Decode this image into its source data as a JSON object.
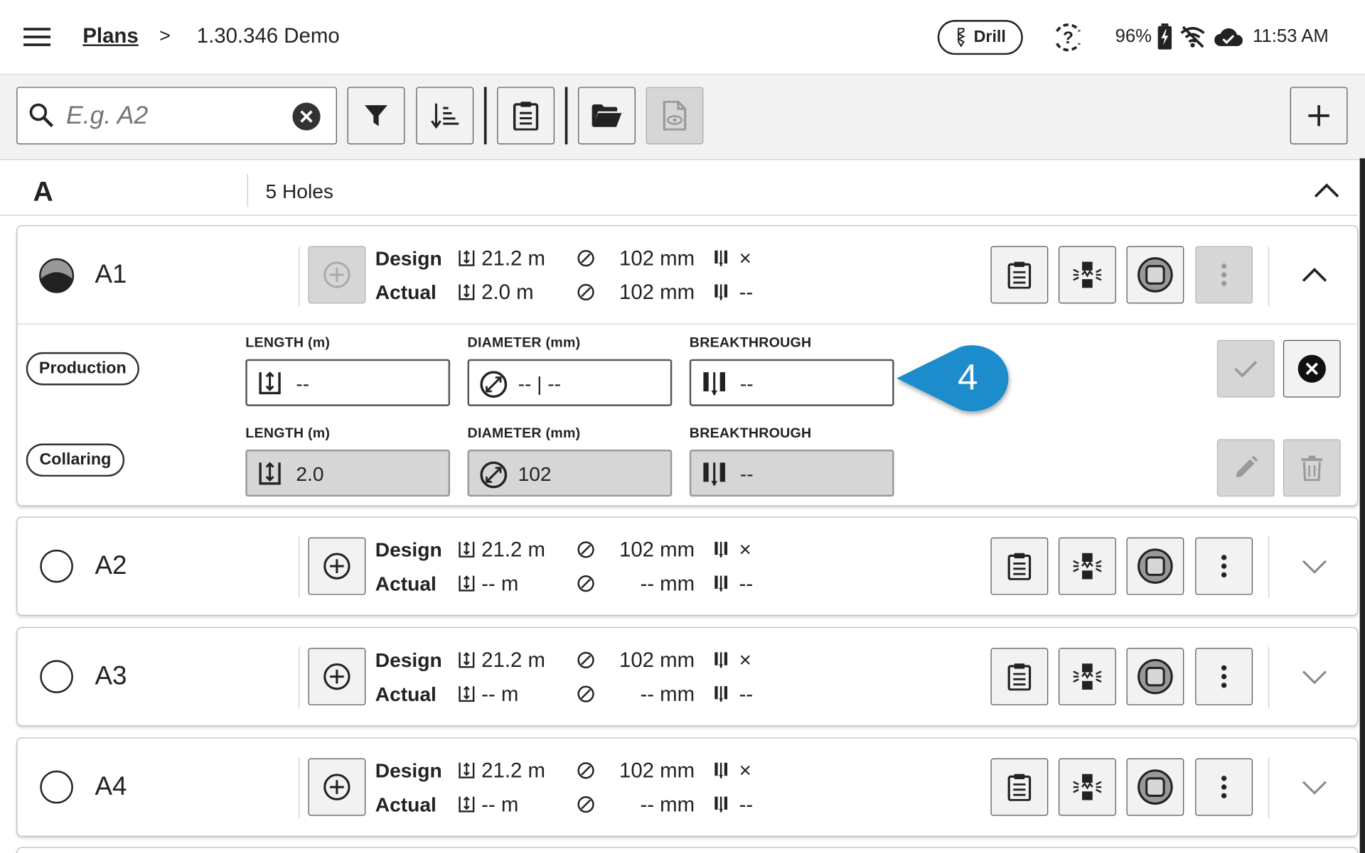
{
  "header": {
    "breadcrumb_link": "Plans",
    "breadcrumb_separator": ">",
    "plan_name": "1.30.346 Demo",
    "mode_label": "Drill",
    "battery": "96%",
    "time": "11:53 AM"
  },
  "search": {
    "placeholder": "E.g. A2",
    "value": ""
  },
  "group": {
    "name": "A",
    "count_label": "5 Holes"
  },
  "labels": {
    "design": "Design",
    "actual": "Actual",
    "length_header": "LENGTH (m)",
    "diameter_header": "DIAMETER (mm)",
    "breakthrough_header": "BREAKTHROUGH",
    "production": "Production",
    "collaring": "Collaring"
  },
  "holes": [
    {
      "id": "A1",
      "status": "partial",
      "expanded": true,
      "design": {
        "length": "21.2 m",
        "diameter": "102 mm",
        "breakthrough": "×"
      },
      "actual": {
        "length": "2.0 m",
        "diameter": "102 mm",
        "breakthrough": "--"
      }
    },
    {
      "id": "A2",
      "status": "empty",
      "expanded": false,
      "design": {
        "length": "21.2 m",
        "diameter": "102 mm",
        "breakthrough": "×"
      },
      "actual": {
        "length": "-- m",
        "diameter": "-- mm",
        "breakthrough": "--"
      }
    },
    {
      "id": "A3",
      "status": "empty",
      "expanded": false,
      "design": {
        "length": "21.2 m",
        "diameter": "102 mm",
        "breakthrough": "×"
      },
      "actual": {
        "length": "-- m",
        "diameter": "-- mm",
        "breakthrough": "--"
      }
    },
    {
      "id": "A4",
      "status": "empty",
      "expanded": false,
      "design": {
        "length": "21.2 m",
        "diameter": "102 mm",
        "breakthrough": "×"
      },
      "actual": {
        "length": "-- m",
        "diameter": "-- mm",
        "breakthrough": "--"
      }
    }
  ],
  "production_inputs": {
    "length": "--",
    "diameter": "-- | --",
    "breakthrough": "--"
  },
  "collaring_values": {
    "length": "2.0",
    "diameter": "102",
    "breakthrough": "--"
  },
  "callout": {
    "number": "4",
    "color": "#1a8ccc"
  },
  "colors": {
    "toolbar_bg": "#f2f2f2",
    "disabled_bg": "#d6d6d6",
    "border": "#555555"
  }
}
